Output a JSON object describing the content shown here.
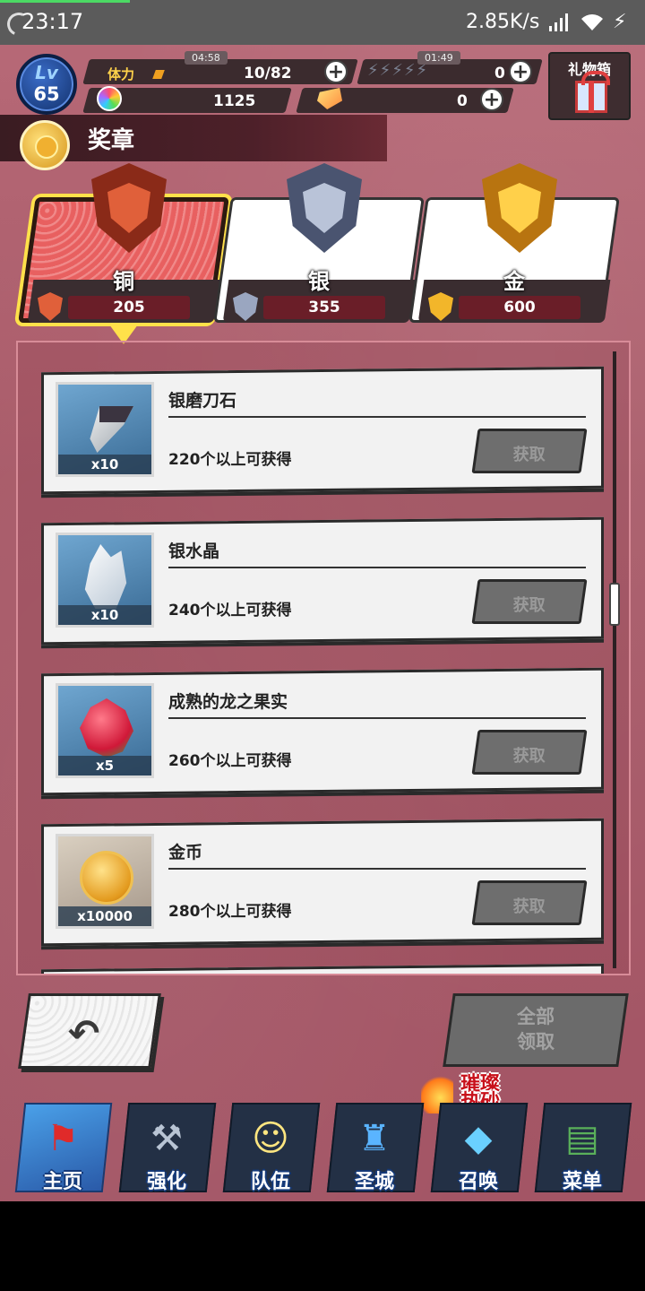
{
  "status_bar": {
    "time": "23:17",
    "net_speed": "2.85K/s"
  },
  "player": {
    "lv_label": "Lv",
    "level": "65"
  },
  "resources": {
    "stamina_label": "体力",
    "stamina": "10/82",
    "stamina_timer": "04:58",
    "feather_timer": "01:49",
    "feathers": "0",
    "rainbow_gems": "1125",
    "orange_gems": "0"
  },
  "gift_box": {
    "label": "礼物箱"
  },
  "section": {
    "title": "奖章"
  },
  "tabs": [
    {
      "name": "铜",
      "count": "205",
      "selected": true,
      "color": "#e0603a"
    },
    {
      "name": "银",
      "count": "355",
      "selected": false,
      "color": "#9aa6c0"
    },
    {
      "name": "金",
      "count": "600",
      "selected": false,
      "color": "#f2b62a"
    }
  ],
  "items": [
    {
      "name": "银磨刀石",
      "qty": "x10",
      "condition": "220个以上可获得",
      "button": "获取",
      "icon": "whetstone-icon"
    },
    {
      "name": "银水晶",
      "qty": "x10",
      "condition": "240个以上可获得",
      "button": "获取",
      "icon": "crystal-icon"
    },
    {
      "name": "成熟的龙之果实",
      "qty": "x5",
      "condition": "260个以上可获得",
      "button": "获取",
      "icon": "dragonfruit-icon"
    },
    {
      "name": "金币",
      "qty": "x10000",
      "condition": "280个以上可获得",
      "button": "获取",
      "icon": "coin-icon"
    }
  ],
  "actions": {
    "claim_all_line1": "全部",
    "claim_all_line2": "领取"
  },
  "event_banner": {
    "line1": "璀璨",
    "line2": "热砂"
  },
  "nav": [
    {
      "label": "主页",
      "icon": "home-flag-icon",
      "active": true
    },
    {
      "label": "强化",
      "icon": "hammer-icon",
      "active": false
    },
    {
      "label": "队伍",
      "icon": "party-icon",
      "active": false
    },
    {
      "label": "圣城",
      "icon": "castle-icon",
      "active": false
    },
    {
      "label": "召唤",
      "icon": "crystal-summon-icon",
      "active": false
    },
    {
      "label": "菜单",
      "icon": "book-icon",
      "active": false
    }
  ]
}
